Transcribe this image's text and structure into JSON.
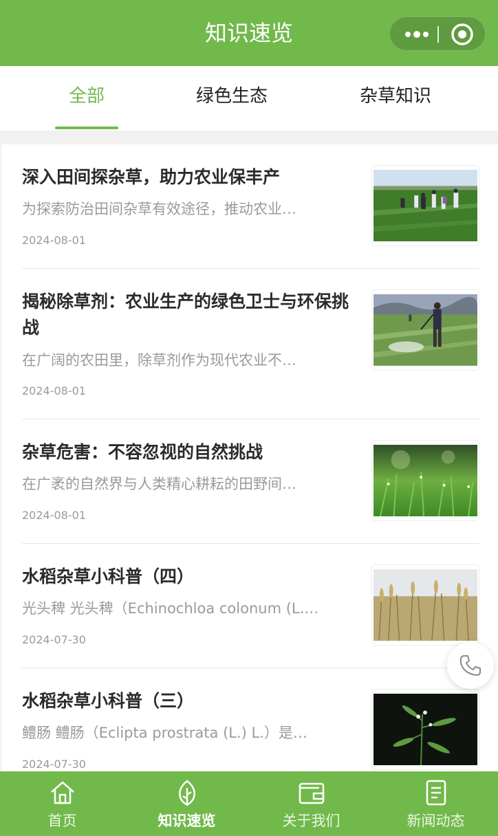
{
  "header": {
    "title": "知识速览"
  },
  "tabs": [
    {
      "label": "全部",
      "active": true
    },
    {
      "label": "绿色生态",
      "active": false
    },
    {
      "label": "杂草知识",
      "active": false
    }
  ],
  "articles": [
    {
      "title": "深入田间探杂草，助力农业保丰产",
      "summary": "为探索防治田间杂草有效途径，推动农业…",
      "date": "2024-08-01",
      "image": "people-in-green-field"
    },
    {
      "title": "揭秘除草剂：农业生产的绿色卫士与环保挑战",
      "summary": "在广阔的农田里，除草剂作为现代农业不…",
      "date": "2024-08-01",
      "image": "farmer-spraying-field"
    },
    {
      "title": "杂草危害：不容忽视的自然挑战",
      "summary": "在广袤的自然界与人类精心耕耘的田野间…",
      "date": "2024-08-01",
      "image": "close-up-grass"
    },
    {
      "title": "水稻杂草小科普（四）",
      "summary": "光头稗 光头稗（Echinochloa colonum (L.…",
      "date": "2024-07-30",
      "image": "wheat-ears"
    },
    {
      "title": "水稻杂草小科普（三）",
      "summary": "鳢肠 鳢肠（Eclipta prostrata (L.) L.）是…",
      "date": "2024-07-30",
      "image": "eclipta-plant-dark"
    }
  ],
  "floating": {
    "icon": "phone-icon"
  },
  "tabbar": [
    {
      "label": "首页",
      "icon": "home-icon",
      "active": false
    },
    {
      "label": "知识速览",
      "icon": "leaf-icon",
      "active": true
    },
    {
      "label": "关于我们",
      "icon": "wallet-icon",
      "active": false
    },
    {
      "label": "新闻动态",
      "icon": "document-icon",
      "active": false
    }
  ],
  "colors": {
    "brand": "#72b94c",
    "active_tab": "#72b94c"
  }
}
